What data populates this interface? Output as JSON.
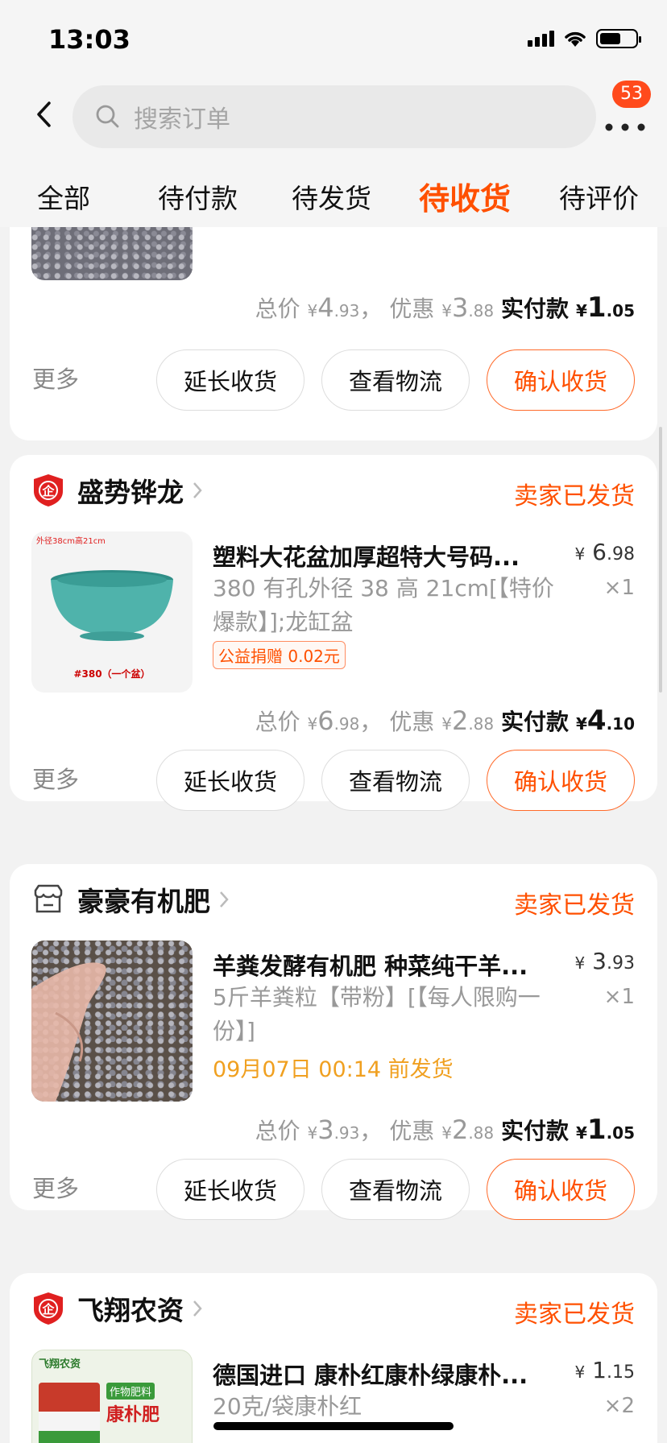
{
  "status_bar": {
    "time": "13:03"
  },
  "header": {
    "search_placeholder": "搜索订单",
    "badge_count": "53"
  },
  "tabs": [
    "全部",
    "待付款",
    "待发货",
    "待收货",
    "待评价"
  ],
  "active_tab": "待收货",
  "common": {
    "more": "更多",
    "extend_button": "延长收货",
    "logistics_button": "查看物流",
    "confirm_button": "确认收货",
    "total_label": "总价",
    "discount_label": "优惠",
    "paid_label": "实付款",
    "yen": "¥",
    "comma": "，"
  },
  "orders": [
    {
      "shop": "",
      "status": "",
      "totals": {
        "total_int": "4",
        "total_dec": ".93",
        "discount_int": "3",
        "discount_dec": ".88",
        "paid_int": "1",
        "paid_dec": ".05"
      }
    },
    {
      "shop": "盛势铧龙",
      "status": "卖家已发货",
      "item": {
        "title": "塑料大花盆加厚超特大号码...",
        "price_int": "6",
        "price_dec": ".98",
        "spec": "380 有孔外径 38 高 21cm[【特价爆款】];龙缸盆",
        "qty": "×1",
        "tag": "公益捐赠 0.02元",
        "thumb_text_top": "外径38cm高21cm",
        "thumb_text_bottom": "#380（一个盆）"
      },
      "totals": {
        "total_int": "6",
        "total_dec": ".98",
        "discount_int": "2",
        "discount_dec": ".88",
        "paid_int": "4",
        "paid_dec": ".10"
      }
    },
    {
      "shop": "豪豪有机肥",
      "status": "卖家已发货",
      "item": {
        "title": "羊粪发酵有机肥 种菜纯干羊...",
        "price_int": "3",
        "price_dec": ".93",
        "spec": "5斤羊粪粒【带粉】[【每人限购一份】]",
        "qty": "×1",
        "ship_time": "09月07日 00:14 前发货"
      },
      "totals": {
        "total_int": "3",
        "total_dec": ".93",
        "discount_int": "2",
        "discount_dec": ".88",
        "paid_int": "1",
        "paid_dec": ".05"
      }
    },
    {
      "shop": "飞翔农资",
      "status": "卖家已发货",
      "item": {
        "title": "德国进口 康朴红康朴绿康朴...",
        "price_int": "1",
        "price_dec": ".15",
        "spec": "20克/袋康朴红",
        "qty": "×2",
        "thumb_brand": "飞翔农资",
        "thumb_label": "作物肥料",
        "thumb_product": "康朴肥"
      }
    }
  ],
  "colors": {
    "accent": "#ff5000",
    "ship_time": "#f0a020",
    "tmall_red": "#e02020"
  }
}
